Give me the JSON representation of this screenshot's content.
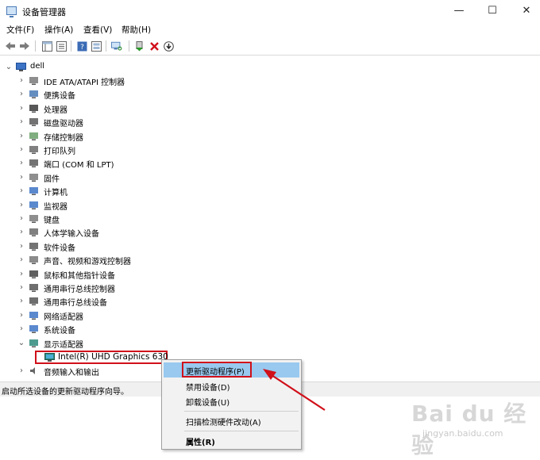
{
  "window": {
    "title": "设备管理器",
    "minimize_glyph": "—",
    "maximize_glyph": "☐",
    "close_glyph": "✕"
  },
  "menu": [
    "文件(F)",
    "操作(A)",
    "查看(V)",
    "帮助(H)"
  ],
  "toolbar": {
    "icons": [
      "back-icon",
      "forward-icon",
      "properties-panel-icon",
      "list-view-icon",
      "help-icon",
      "show-hidden-icon",
      "scan-hardware-icon",
      "update-driver-icon",
      "uninstall-icon",
      "download-icon"
    ]
  },
  "tree": {
    "root": "dell",
    "categories": [
      "IDE ATA/ATAPI 控制器",
      "便携设备",
      "处理器",
      "磁盘驱动器",
      "存储控制器",
      "打印队列",
      "端口 (COM 和 LPT)",
      "固件",
      "计算机",
      "监视器",
      "键盘",
      "人体学输入设备",
      "软件设备",
      "声音、视频和游戏控制器",
      "鼠标和其他指针设备",
      "通用串行总线控制器",
      "通用串行总线设备",
      "网络适配器",
      "系统设备",
      "显示适配器"
    ],
    "expanded_child": "Intel(R) UHD Graphics 630",
    "after": "音频输入和输出"
  },
  "status": "启动所选设备的更新驱动程序向导。",
  "context_menu": {
    "items": [
      "更新驱动程序(P)",
      "禁用设备(D)",
      "卸载设备(U)",
      "扫描检测硬件改动(A)",
      "属性(R)"
    ]
  },
  "watermark": {
    "main": "Bai du 经验",
    "sub": "jingyan.baidu.com"
  },
  "colors": {
    "highlight": "#99c9ef",
    "annotation_red": "#d0101a",
    "uninstall_red": "#d0101a"
  }
}
